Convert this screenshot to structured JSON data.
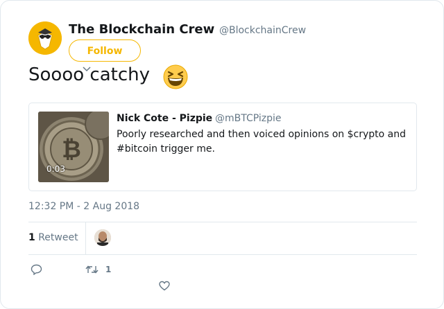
{
  "author": {
    "name": "The Blockchain Crew",
    "handle": "@BlockchainCrew",
    "follow_label": "Follow"
  },
  "tweet": {
    "text": "Soooo catchy",
    "timestamp": "12:32 PM - 2 Aug 2018"
  },
  "quoted_tweet": {
    "name": "Nick Cote - Pizpie",
    "handle": "@mBTCPizpie",
    "text": "Poorly researched and then voiced opinions on $crypto and #bitcoin trigger me.",
    "video_duration": "0:03"
  },
  "stats": {
    "retweet_count": "1",
    "retweet_label": "Retweet"
  },
  "actions": {
    "retweet_count": "1"
  },
  "icons": {
    "reply": "reply-icon",
    "retweet": "retweet-icon",
    "like": "heart-icon",
    "emoji": "grinning-squinting-face-emoji"
  },
  "colors": {
    "brand": "#f5b700",
    "text": "#14171a",
    "muted": "#657786",
    "border": "#e1e8ed"
  }
}
